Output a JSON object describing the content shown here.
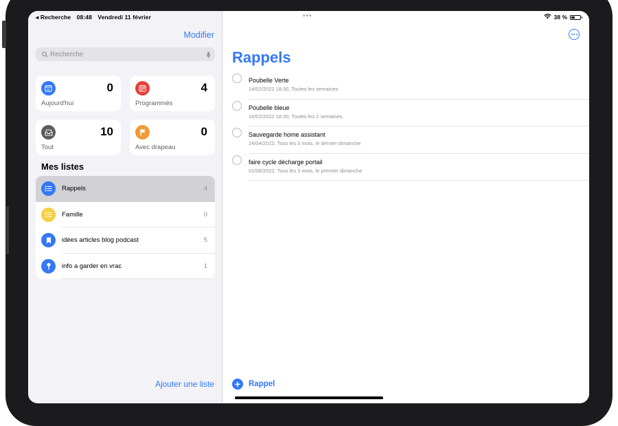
{
  "status_bar": {
    "back_label": "◂ Recherche",
    "time": "08:48",
    "date": "Vendredi 11 février",
    "battery": "38 %",
    "battery_level": 0.38
  },
  "sidebar": {
    "edit_label": "Modifier",
    "search_placeholder": "Recherche",
    "smart_lists": [
      {
        "label": "Aujourd'hui",
        "count": "0",
        "color": "#3478f6",
        "icon": "calendar-icon"
      },
      {
        "label": "Programmés",
        "count": "4",
        "color": "#e5403b",
        "icon": "calendar-grid-icon"
      },
      {
        "label": "Tout",
        "count": "10",
        "color": "#5b5b60",
        "icon": "tray-icon"
      },
      {
        "label": "Avec drapeau",
        "count": "0",
        "color": "#f19a37",
        "icon": "flag-icon"
      }
    ],
    "section_title": "Mes listes",
    "lists": [
      {
        "name": "Rappels",
        "count": "4",
        "color": "#3478f6",
        "icon": "list-icon"
      },
      {
        "name": "Famille",
        "count": "0",
        "color": "#f6cf45",
        "icon": "list-icon"
      },
      {
        "name": "idées articles blog podcast",
        "count": "5",
        "color": "#3478f6",
        "icon": "bookmark-icon"
      },
      {
        "name": "info a garder en vrac",
        "count": "1",
        "color": "#3478f6",
        "icon": "pin-icon"
      }
    ],
    "add_list_label": "Ajouter une liste"
  },
  "main": {
    "title": "Rappels",
    "reminders": [
      {
        "title": "Poubelle Verte",
        "subtitle": "14/02/2022 18:30, Toutes les semaines"
      },
      {
        "title": "Poubelle bleue",
        "subtitle": "16/02/2022 18:30, Toutes les 2 semaines"
      },
      {
        "title": "Sauvegarde home assistant",
        "subtitle": "24/04/2022, Tous les 3 mois, le dernier dimanche"
      },
      {
        "title": "faire cycle décharge portail",
        "subtitle": "01/06/2022, Tous les 3 mois, le premier dimanche"
      }
    ],
    "new_reminder_label": "Rappel"
  },
  "colors": {
    "accent": "#3478f6",
    "sidebar_bg": "#f2f2f7",
    "selected_row": "#d1d1d6"
  }
}
